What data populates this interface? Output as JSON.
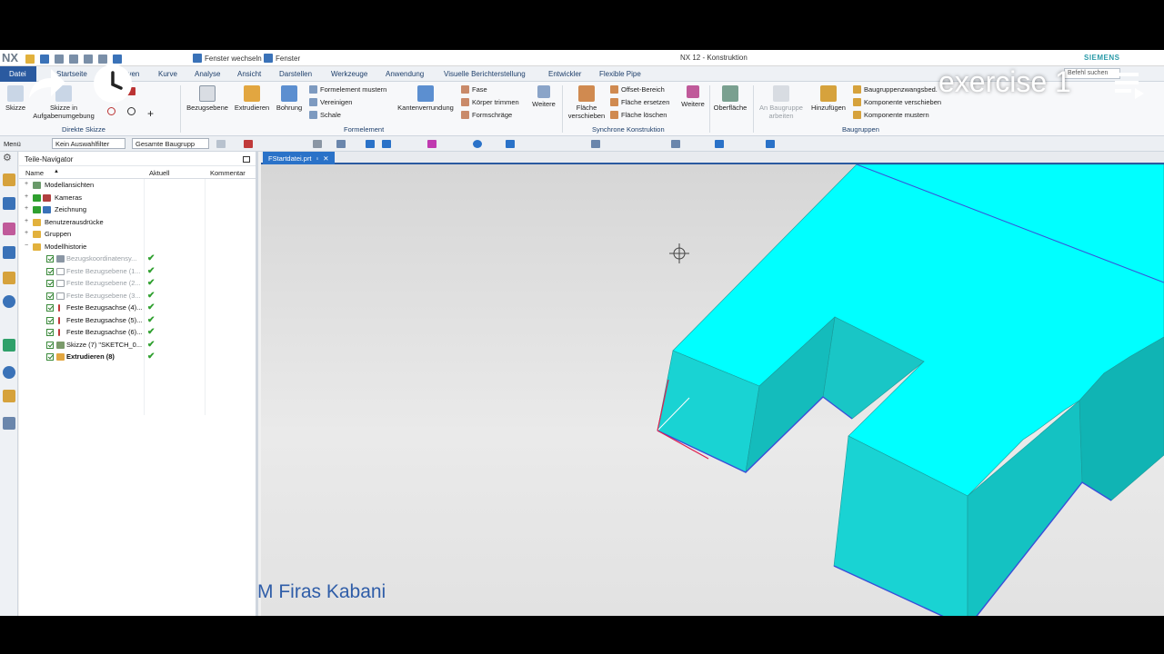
{
  "titlebar": {
    "logo": "NX",
    "switch_window": "Fenster wechseln",
    "window": "Fenster",
    "title": "NX 12 - Konstruktion",
    "brand": "SIEMENS"
  },
  "menu": {
    "file": "Datei",
    "tabs": [
      "Startseite",
      "Kurven",
      "Kurve",
      "Analyse",
      "Ansicht",
      "Darstellen",
      "Werkzeuge",
      "Anwendung",
      "Visuelle Berichterstellung",
      "Entwickler",
      "Flexible Pipe"
    ],
    "search_placeholder": "Befehl suchen"
  },
  "ribbon": {
    "sketch": "Skizze",
    "sketch_task": "Skizze in Aufgabenumgebung",
    "group_direct_sketch": "Direkte Skizze",
    "datum_plane": "Bezugsebene",
    "extrude": "Extrudieren",
    "hole": "Bohrung",
    "pattern_feature": "Formelement mustern",
    "unite": "Vereinigen",
    "shell": "Schale",
    "group_feature": "Formelement",
    "edge_blend": "Kantenverrundung",
    "chamfer": "Fase",
    "trim_body": "Körper trimmen",
    "draft": "Formschräge",
    "more1": "Weitere",
    "move_face": "Fläche verschieben",
    "offset_region": "Offset-Bereich",
    "replace_face": "Fläche ersetzen",
    "delete_face": "Fläche löschen",
    "group_sync": "Synchrone Konstruktion",
    "more2": "Weitere",
    "surface": "Oberfläche",
    "on_assembly": "An Baugruppe arbeiten",
    "add": "Hinzufügen",
    "assembly_constraints": "Baugruppenzwangsbed.",
    "move_component": "Komponente verschieben",
    "pattern_component": "Komponente mustern",
    "group_assemblies": "Baugruppen"
  },
  "selection_bar": {
    "menu": "Menü",
    "filter": "Kein Auswahlfilter",
    "scope": "Gesamte Baugrupp"
  },
  "navigator": {
    "title": "Teile-Navigator",
    "columns": [
      "Name",
      "Aktuell",
      "Kommentar"
    ],
    "items": [
      {
        "label": "Modellansichten"
      },
      {
        "label": "Kameras"
      },
      {
        "label": "Zeichnung"
      },
      {
        "label": "Benutzerausdrücke"
      },
      {
        "label": "Gruppen"
      },
      {
        "label": "Modellhistorie"
      },
      {
        "label": "Bezugskoordinatensy..."
      },
      {
        "label": "Feste Bezugsebene (1..."
      },
      {
        "label": "Feste Bezugsebene (2..."
      },
      {
        "label": "Feste Bezugsebene (3..."
      },
      {
        "label": "Feste Bezugsachse (4)..."
      },
      {
        "label": "Feste Bezugsachse (5)..."
      },
      {
        "label": "Feste Bezugsachse (6)..."
      },
      {
        "label": "Skizze (7) \"SKETCH_0..."
      },
      {
        "label": "Extrudieren (8)"
      }
    ]
  },
  "doc_tab": "FStartdatei.prt",
  "watermark": "M Firas Kabani",
  "overlay": {
    "title": "exercise 1"
  },
  "colors": {
    "model_top": "#00ffff",
    "model_side": "#19d3d3",
    "accent": "#2a5aa0"
  },
  "icons": [
    "share-icon",
    "clock-icon",
    "playlist-icon",
    "crosshair-icon"
  ]
}
